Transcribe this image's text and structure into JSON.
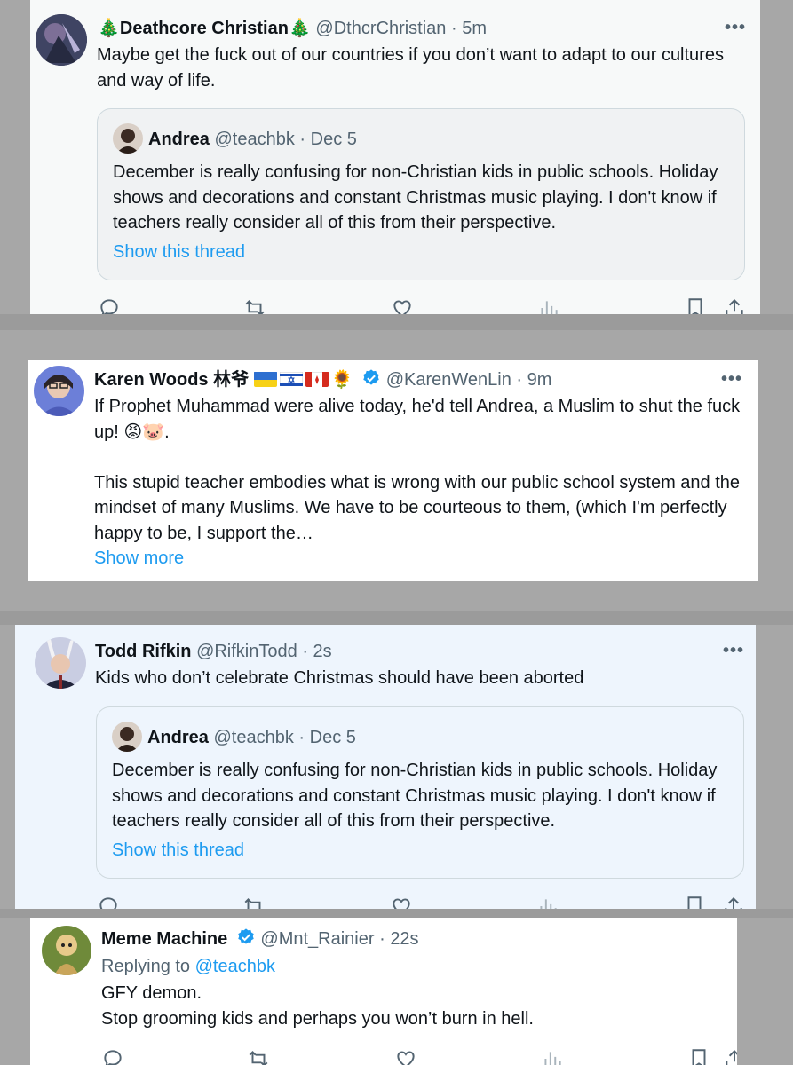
{
  "tweets": [
    {
      "name": "🎄Deathcore Christian🎄",
      "handle": "@DthcrChristian",
      "sep": "·",
      "time": "5m",
      "text": "Maybe get the fuck out of our countries if you don’t want to adapt to our cultures and way of life.",
      "quote": {
        "name": "Andrea",
        "handle": "@teachbk",
        "sep": "·",
        "time": "Dec 5",
        "text": "December is really confusing for non-Christian kids in public schools. Holiday shows and decorations and constant Christmas music playing. I don't know if teachers really consider all of this from their perspective.",
        "link": "Show this thread"
      }
    },
    {
      "name": "Karen Woods 林爷",
      "emoji_sunflower": "🌻",
      "handle": "@KarenWenLin",
      "sep": "·",
      "time": "9m",
      "text_line1": "If Prophet Muhammad were alive today, he'd tell Andrea, a Muslim to shut the fuck up! 😡🐷.",
      "text_para2": "This stupid teacher embodies what is wrong with our public school system and the mindset of many Muslims. We have to be courteous to them, (which I'm perfectly happy to be, I support the…",
      "show_more": "Show more"
    },
    {
      "name": "Todd Rifkin",
      "handle": "@RifkinTodd",
      "sep": "·",
      "time": "2s",
      "text": "Kids who don’t celebrate Christmas should have been aborted",
      "quote": {
        "name": "Andrea",
        "handle": "@teachbk",
        "sep": "·",
        "time": "Dec 5",
        "text": "December is really confusing for non-Christian kids in public schools. Holiday shows and decorations and constant Christmas music playing. I don't know if teachers really consider all of this from their perspective.",
        "link": "Show this thread"
      }
    },
    {
      "name": "Meme Machine",
      "handle": "@Mnt_Rainier",
      "sep": "·",
      "time": "22s",
      "replying_to_label": "Replying to",
      "replying_to_handle": "@teachbk",
      "text_line1": "GFY demon.",
      "text_line2": "Stop grooming kids and perhaps you won’t burn in hell."
    }
  ],
  "more_glyph": "•••",
  "icons": [
    "reply-icon",
    "retweet-icon",
    "like-icon",
    "views-icon",
    "bookmark-icon",
    "share-icon"
  ],
  "colors": {
    "link": "#1d9bf0",
    "secondary_text": "#536471",
    "verified": "#1d9bf0",
    "highlight_bg": "#eef5fd"
  }
}
